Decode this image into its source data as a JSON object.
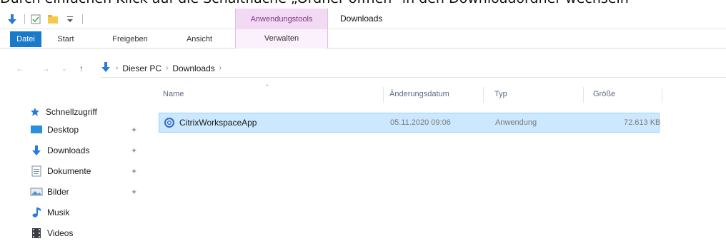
{
  "caption": {
    "text": "Durch einfachen Klick auf die Schaltfläche „Ordner öffnen“ in den Downloadordner wechseln"
  },
  "titlebar": {
    "context_group": "Anwendungstools",
    "window_title": "Downloads",
    "icons": [
      "download-arrow-icon",
      "properties-icon",
      "new-folder-icon",
      "customize-dropdown-icon"
    ]
  },
  "ribbon": {
    "tabs": [
      {
        "label": "Datei"
      },
      {
        "label": "Start"
      },
      {
        "label": "Freigeben"
      },
      {
        "label": "Ansicht"
      },
      {
        "label": "Verwalten"
      }
    ]
  },
  "addressbar": {
    "path": [
      "Dieser PC",
      "Downloads"
    ]
  },
  "navigation": {
    "items": [
      {
        "label": "Schnellzugriff",
        "icon": "star-icon",
        "pinned": false
      },
      {
        "label": "Desktop",
        "icon": "desktop-icon",
        "pinned": true
      },
      {
        "label": "Downloads",
        "icon": "download-arrow-icon",
        "pinned": true
      },
      {
        "label": "Dokumente",
        "icon": "documents-icon",
        "pinned": true
      },
      {
        "label": "Bilder",
        "icon": "pictures-icon",
        "pinned": true
      },
      {
        "label": "Musik",
        "icon": "music-icon",
        "pinned": false
      },
      {
        "label": "Videos",
        "icon": "videos-icon",
        "pinned": false
      }
    ]
  },
  "filelist": {
    "columns": [
      "Name",
      "Änderungsdatum",
      "Typ",
      "Größe"
    ],
    "rows": [
      {
        "name": "CitrixWorkspaceApp",
        "date": "05.11.2020 09:06",
        "type": "Anwendung",
        "size": "72.613 KB",
        "selected": true
      }
    ]
  },
  "colors": {
    "file_tab": "#1979ca",
    "context_tab": "#f2d9f4",
    "selection": "#cce8ff",
    "selection_border": "#99d1ff"
  }
}
